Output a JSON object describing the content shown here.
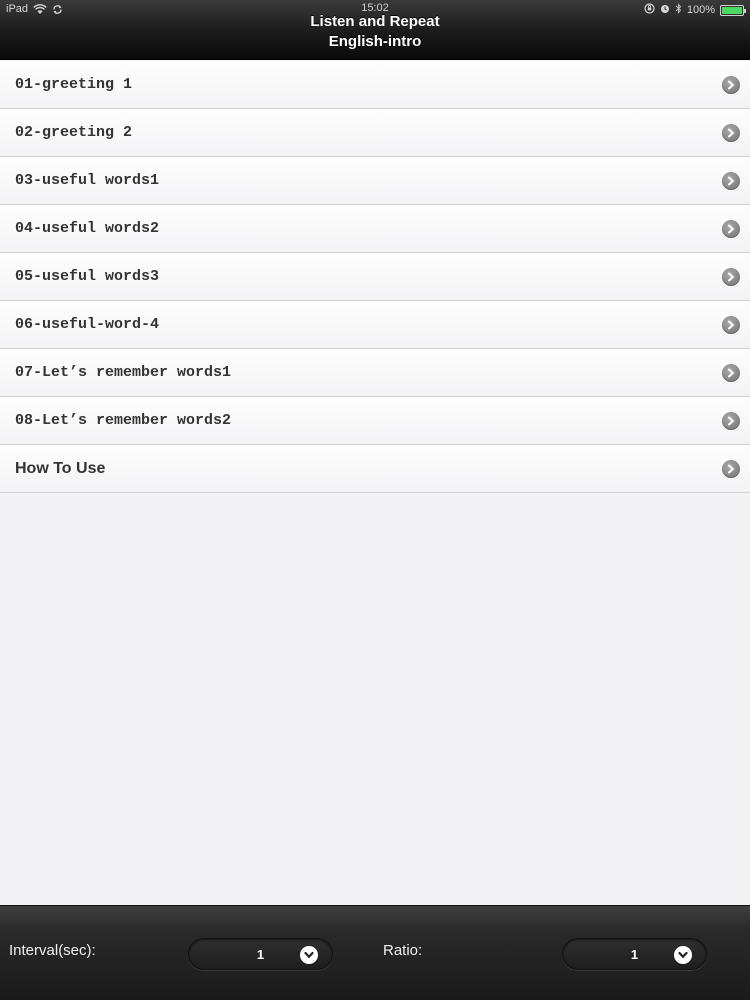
{
  "status_bar": {
    "device": "iPad",
    "time": "15:02",
    "battery": "100%"
  },
  "header": {
    "title_line1": "Listen and Repeat",
    "title_line2": "English-intro"
  },
  "list": {
    "items": [
      {
        "label": "01-greeting 1"
      },
      {
        "label": "02-greeting 2"
      },
      {
        "label": "03-useful words1"
      },
      {
        "label": "04-useful words2"
      },
      {
        "label": "05-useful words3"
      },
      {
        "label": "06-useful-word-4"
      },
      {
        "label": "07-Let’s remember words1"
      },
      {
        "label": "08-Let’s remember words2"
      },
      {
        "label": "How To Use"
      }
    ]
  },
  "controls": {
    "interval_label": "Interval(sec):",
    "interval_value": "1",
    "ratio_label": "Ratio:",
    "ratio_value": "1"
  },
  "colors": {
    "battery_green": "#4cd964",
    "list_background": "#f2f2f4"
  }
}
